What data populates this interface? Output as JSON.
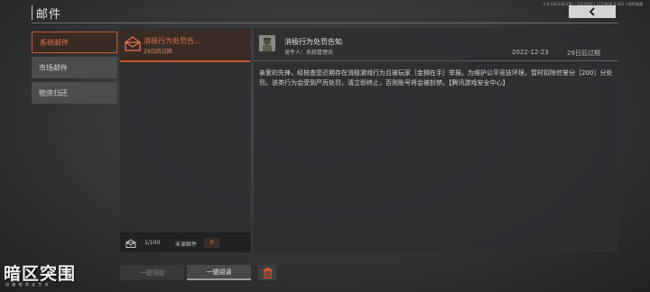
{
  "header": {
    "title": "邮件",
    "version": "1.0.128.128.25U | 1223087 | 3733006.0.161 | HDR高清"
  },
  "nav": {
    "items": [
      {
        "label": "系统邮件"
      },
      {
        "label": "市场邮件"
      },
      {
        "label": "物资归还"
      }
    ]
  },
  "mail_list": {
    "items": [
      {
        "subject": "消极行为处罚告...",
        "expire": "29日后过期"
      }
    ],
    "count": "1/100",
    "unread_label": "未读邮件",
    "unread_count": "0"
  },
  "detail": {
    "title": "消极行为处罚告知",
    "sender": "发件人：系统管理员",
    "date": "2022-12-23",
    "expire": "29日后过期",
    "body": "亲爱的先锋，经核查您近期存在消极游戏行为且被玩家［金狮在手］举报。为维护公平竞技环境，暂时扣除信誉分［200］分处罚。该类行为会受到严厉处罚，请立即终止，否则账号将会被封禁。【腾讯游戏安全中心】"
  },
  "actions": {
    "claim_all": "一键领取",
    "read_all": "一键阅读"
  },
  "logo": {
    "name": "暗区突围",
    "tagline": "自 建 规 则 去 生 存"
  },
  "colors": {
    "accent": "#c8552d",
    "accent_text": "#e2744b",
    "panel": "#2e2f31"
  }
}
